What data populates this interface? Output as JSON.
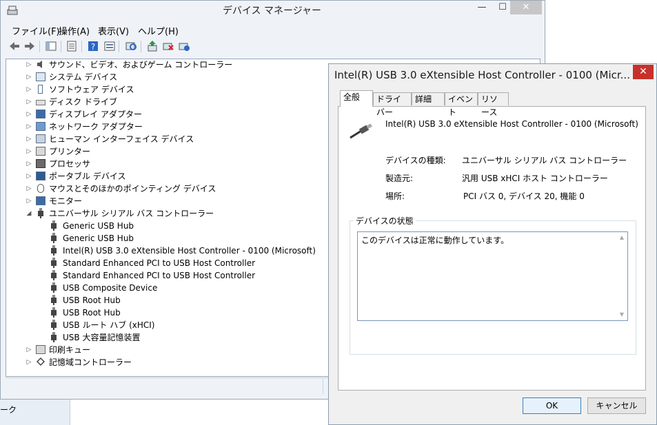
{
  "device_manager": {
    "title": "デバイス マネージャー",
    "menu": [
      "ファイル(F)",
      "操作(A)",
      "表示(V)",
      "ヘルプ(H)"
    ],
    "caption_buttons": {
      "minimize": "—",
      "maximize": "☐",
      "close": "✕"
    },
    "toolbar_icons": [
      "back-icon",
      "forward-icon",
      "show-hide-tree-icon",
      "properties-icon",
      "help-icon",
      "view-icon",
      "scan-hardware-icon",
      "update-driver-icon",
      "disable-device-icon",
      "uninstall-device-icon"
    ],
    "tree": {
      "categories_top": [
        {
          "label": "サウンド、ビデオ、およびゲーム コントローラー",
          "icon": "speaker-icon"
        },
        {
          "label": "システム デバイス",
          "icon": "system-icon"
        },
        {
          "label": "ソフトウェア デバイス",
          "icon": "software-icon"
        },
        {
          "label": "ディスク ドライブ",
          "icon": "disk-icon"
        },
        {
          "label": "ディスプレイ アダプター",
          "icon": "display-icon"
        },
        {
          "label": "ネットワーク アダプター",
          "icon": "network-icon"
        },
        {
          "label": "ヒューマン インターフェイス デバイス",
          "icon": "hid-icon"
        },
        {
          "label": "プリンター",
          "icon": "printer-icon"
        },
        {
          "label": "プロセッサ",
          "icon": "processor-icon"
        },
        {
          "label": "ポータブル デバイス",
          "icon": "portable-icon"
        },
        {
          "label": "マウスとそのほかのポインティング デバイス",
          "icon": "mouse-icon"
        },
        {
          "label": "モニター",
          "icon": "monitor-icon"
        }
      ],
      "usb_category": "ユニバーサル シリアル バス コントローラー",
      "usb_children": [
        "Generic USB Hub",
        "Generic USB Hub",
        "Intel(R) USB 3.0 eXtensible Host Controller - 0100 (Microsoft)",
        "Standard Enhanced PCI to USB Host Controller",
        "Standard Enhanced PCI to USB Host Controller",
        "USB Composite Device",
        "USB Root Hub",
        "USB Root Hub",
        "USB ルート ハブ (xHCI)",
        "USB 大容量記憶装置"
      ],
      "categories_bottom": [
        {
          "label": "印刷キュー",
          "icon": "print-queue-icon"
        },
        {
          "label": "記憶域コントローラー",
          "icon": "storage-controller-icon"
        }
      ]
    },
    "bottom_left_text": "ーク"
  },
  "dialog": {
    "title": "Intel(R) USB 3.0 eXtensible Host Controller - 0100 (Micr...",
    "close": "✕",
    "tabs": [
      "全般",
      "ドライバー",
      "詳細",
      "イベント",
      "リソース"
    ],
    "active_tab": 0,
    "device_name": "Intel(R) USB 3.0 eXtensible Host Controller - 0100 (Microsoft)",
    "properties": [
      {
        "key": "デバイスの種類:",
        "value": "ユニバーサル シリアル バス コントローラー"
      },
      {
        "key": "製造元:",
        "value": "汎用 USB xHCI ホスト コントローラー"
      },
      {
        "key": "場所:",
        "value": "PCI バス 0, デバイス 20, 機能 0"
      }
    ],
    "status_legend": "デバイスの状態",
    "status_text": "このデバイスは正常に動作しています。",
    "ok_label": "OK",
    "cancel_label": "キャンセル"
  }
}
